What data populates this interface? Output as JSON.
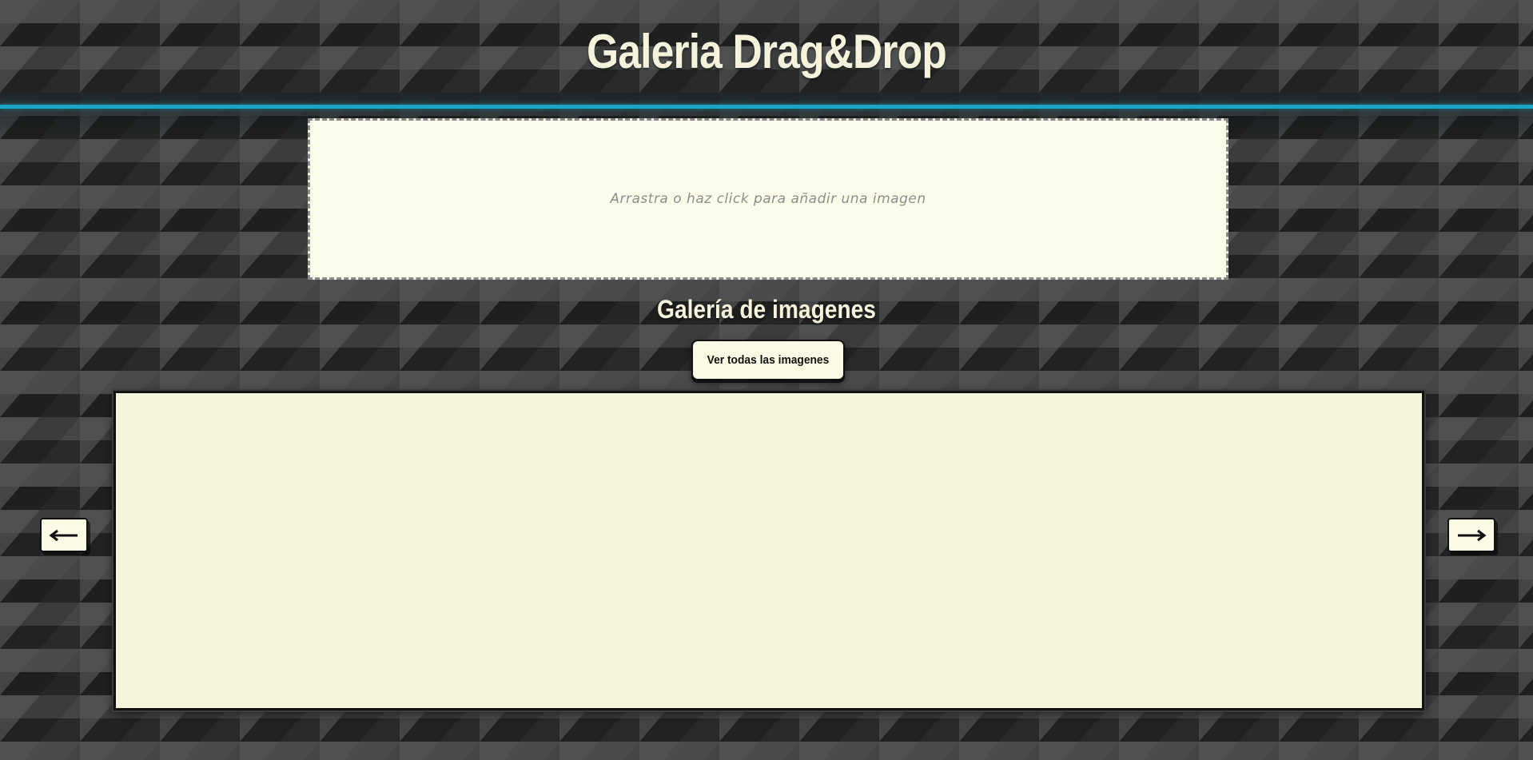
{
  "header": {
    "title": "Galeria Drag&Drop"
  },
  "dropzone": {
    "text": "Arrastra o haz click para añadir una imagen"
  },
  "gallery": {
    "title": "Galería de imagenes",
    "view_all_label": "Ver todas las imagenes",
    "images": []
  },
  "navigation": {
    "prev_icon": "arrow-left-icon",
    "next_icon": "arrow-right-icon"
  },
  "colors": {
    "accent": "#1aa6c6",
    "title_text": "#f5f3dc",
    "panel_background": "#f5f4dc",
    "dropzone_background": "#fbfcea",
    "button_background": "#fbfae4"
  }
}
